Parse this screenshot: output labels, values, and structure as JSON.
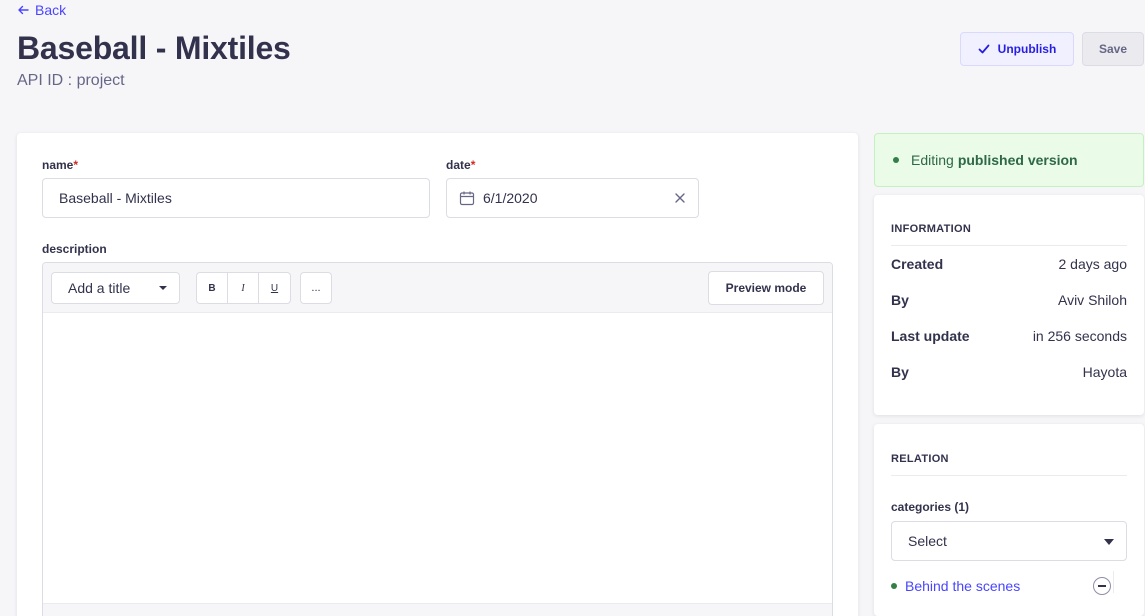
{
  "nav": {
    "back_label": "Back"
  },
  "header": {
    "title": "Baseball - Mixtiles",
    "api_id": "API ID : project",
    "unpublish_label": "Unpublish",
    "save_label": "Save"
  },
  "form": {
    "name": {
      "label": "name",
      "required": "*",
      "value": "Baseball - Mixtiles"
    },
    "date": {
      "label": "date",
      "required": "*",
      "value": "6/1/2020"
    },
    "description": {
      "label": "description",
      "title_select": "Add a title",
      "bold": "B",
      "italic": "I",
      "underline": "U",
      "more": "...",
      "preview_label": "Preview mode"
    }
  },
  "status": {
    "prefix": "Editing",
    "emphasis": "published version"
  },
  "information": {
    "title": "INFORMATION",
    "rows": [
      {
        "key": "Created",
        "value": "2 days ago"
      },
      {
        "key": "By",
        "value": "Aviv Shiloh"
      },
      {
        "key": "Last update",
        "value": "in 256 seconds"
      },
      {
        "key": "By",
        "value": "Hayota"
      }
    ]
  },
  "relation": {
    "title": "RELATION",
    "field_label": "categories (1)",
    "select_placeholder": "Select",
    "items": [
      {
        "label": "Behind the scenes"
      }
    ]
  },
  "colors": {
    "primary": "#4945ff",
    "success": "#328048",
    "danger": "#d02b20"
  }
}
